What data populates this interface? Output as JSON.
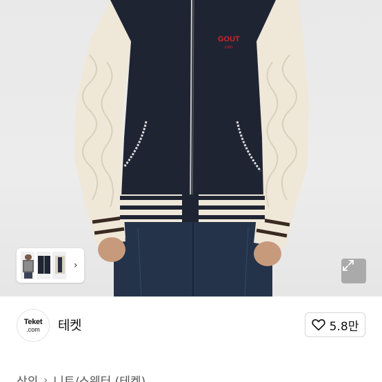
{
  "product": {
    "jacket_logo_text": "GOUT",
    "jacket_logo_sub": ".com"
  },
  "gallery": {
    "thumbnail_count": 3,
    "next_arrow": "›",
    "expand_icon": "expand-icon"
  },
  "seller": {
    "avatar_line1": "Teket",
    "avatar_line2": ".com",
    "name": "테켓"
  },
  "like": {
    "icon": "heart-icon",
    "count": "5.8만"
  },
  "breadcrumb": {
    "items": [
      "상의",
      "니트/스웨터 (테켓)"
    ],
    "separator": "›"
  },
  "colors": {
    "navy": "#1f2433",
    "cream": "#efe8d8",
    "accent_red": "#d0262b",
    "denim": "#243349"
  }
}
